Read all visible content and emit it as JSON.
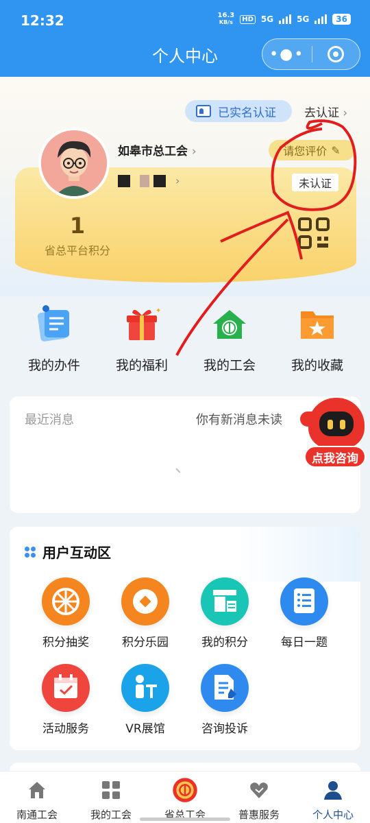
{
  "status_bar": {
    "time": "12:32",
    "speed_value": "16.3",
    "speed_unit": "KB/s",
    "hd_label": "HD",
    "net1": "5G",
    "net2": "5G",
    "battery": "36"
  },
  "header": {
    "title": "个人中心",
    "more_icon": "more-dots-icon",
    "close_icon": "target-icon"
  },
  "profile": {
    "verified_label": "已实名认证",
    "go_verify": "去认证",
    "org_name": "如皋市总工会",
    "rate_label": "请您评价",
    "unverified_label": "未认证",
    "points_value": "1",
    "points_label": "省总平台积分",
    "qr_icon": "qrcode-icon"
  },
  "quick_actions": [
    {
      "label": "我的办件",
      "icon": "document-icon",
      "color": "#4aa3f5"
    },
    {
      "label": "我的福利",
      "icon": "gift-icon",
      "color": "#e8322a"
    },
    {
      "label": "我的工会",
      "icon": "union-house-icon",
      "color": "#27b04b"
    },
    {
      "label": "我的收藏",
      "icon": "star-folder-icon",
      "color": "#f58a1f"
    }
  ],
  "messages": {
    "title": "最近消息",
    "new_text": "你有新消息未读",
    "consult_label": "点我咨询"
  },
  "interaction": {
    "title": "用户互动区",
    "items": [
      {
        "label": "积分抽奖",
        "icon": "wheel-icon",
        "color": "#f5851f"
      },
      {
        "label": "积分乐园",
        "icon": "coin-icon",
        "color": "#f5851f"
      },
      {
        "label": "我的积分",
        "icon": "points-store-icon",
        "color": "#19c6b5"
      },
      {
        "label": "每日一题",
        "icon": "quiz-list-icon",
        "color": "#2f8af0"
      },
      {
        "label": "活动服务",
        "icon": "calendar-check-icon",
        "color": "#f0453c"
      },
      {
        "label": "VR展馆",
        "icon": "vr-person-icon",
        "color": "#1aa3e8"
      },
      {
        "label": "咨询投诉",
        "icon": "edit-doc-icon",
        "color": "#2f8af0"
      }
    ]
  },
  "tabbar": [
    {
      "label": "南通工会",
      "icon": "home-icon"
    },
    {
      "label": "我的工会",
      "icon": "grid-icon"
    },
    {
      "label": "省总工会",
      "icon": "union-emblem-icon"
    },
    {
      "label": "普惠服务",
      "icon": "heart-hand-icon"
    },
    {
      "label": "个人中心",
      "icon": "person-icon",
      "active": true
    }
  ]
}
